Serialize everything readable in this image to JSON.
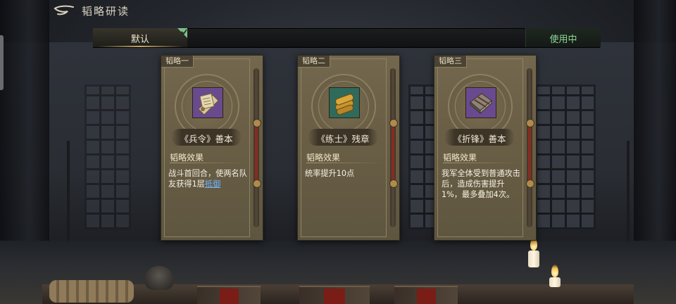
{
  "header": {
    "title": "韬略研读",
    "back_icon": "back-arrow-icon"
  },
  "tabs": {
    "default_label": "默认",
    "in_use_label": "使用中"
  },
  "cards": [
    {
      "tag": "韬略一",
      "name": "《兵令》善本",
      "icon": "scroll-icon",
      "effect_title": "韬略效果",
      "effect_text": "战斗首回合，使两名队友获得1层",
      "effect_link": "抵御"
    },
    {
      "tag": "韬略二",
      "name": "《练士》残章",
      "icon": "bamboo-slips-icon",
      "effect_title": "韬略效果",
      "effect_text": "统率提升10点",
      "effect_link": ""
    },
    {
      "tag": "韬略三",
      "name": "《折锋》善本",
      "icon": "book-icon",
      "effect_title": "韬略效果",
      "effect_text": "我军全体受到普通攻击后，造成伤害提升1%，最多叠加4次。",
      "effect_link": ""
    }
  ],
  "colors": {
    "accent_gold": "#c9a96a",
    "in_use_green": "#8fd89b",
    "link_blue": "#6fb6ff"
  }
}
